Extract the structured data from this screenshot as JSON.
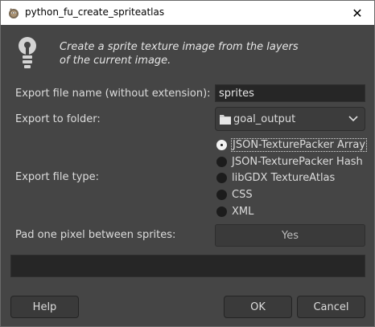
{
  "window": {
    "title": "python_fu_create_spriteatlas",
    "close_glyph": "✕",
    "app_icon": "gimp-icon"
  },
  "hint": {
    "icon": "lightbulb-icon",
    "line1": "Create a sprite texture image from the layers",
    "line2": "of the current image."
  },
  "fields": {
    "filename_label": "Export file name (without extension):",
    "filename_value": "sprites",
    "folder_label": "Export to folder:",
    "folder_value": "goal_output",
    "filetype_label": "Export file type:",
    "pad_label": "Pad one pixel between sprites:",
    "pad_value": "Yes"
  },
  "filetypes": [
    {
      "label": "JSON-TexturePacker Array",
      "checked": true
    },
    {
      "label": "JSON-TexturePacker Hash",
      "checked": false
    },
    {
      "label": "libGDX TextureAtlas",
      "checked": false
    },
    {
      "label": "CSS",
      "checked": false
    },
    {
      "label": "XML",
      "checked": false
    }
  ],
  "progress": {
    "fraction": 0
  },
  "buttons": {
    "help": "Help",
    "ok": "OK",
    "cancel": "Cancel"
  },
  "colors": {
    "background": "#454545",
    "entry_background": "#262626",
    "accent": "#5a86c0"
  }
}
